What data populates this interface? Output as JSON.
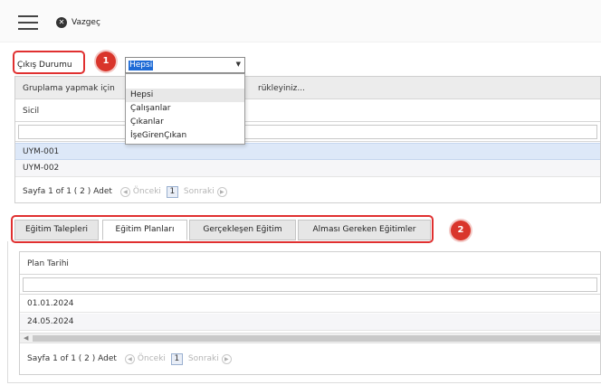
{
  "toolbar": {
    "cancel_label": "Vazgeç",
    "menu_icon": "hamburger-icon",
    "cancel_icon": "close-circle-icon"
  },
  "filter": {
    "label": "Çıkış Durumu",
    "selected": "Hepsi",
    "options": [
      "Hepsi",
      "Çalışanlar",
      "Çıkanlar",
      "İşeGirenÇıkan"
    ]
  },
  "badges": {
    "first": "1",
    "second": "2"
  },
  "top_grid": {
    "group_hint_start": "Gruplama yapmak için",
    "group_hint_end": "rükleyiniz...",
    "column": "Sicil",
    "rows": [
      "UYM-001",
      "UYM-002"
    ],
    "pager": {
      "summary": "Sayfa 1 of 1 ( 2 ) Adet",
      "prev": "Önceki",
      "page": "1",
      "next": "Sonraki"
    }
  },
  "tabs": [
    "Eğitim Talepleri",
    "Eğitim Planları",
    "Gerçekleşen Eğitim",
    "Alması Gereken Eğitimler"
  ],
  "active_tab": "Eğitim Planları",
  "bottom_grid": {
    "column": "Plan Tarihi",
    "rows": [
      "01.01.2024",
      "24.05.2024"
    ],
    "pager": {
      "summary": "Sayfa 1 of 1 ( 2 ) Adet",
      "prev": "Önceki",
      "page": "1",
      "next": "Sonraki"
    }
  },
  "colors": {
    "accent_red": "#e03030",
    "badge_red": "#d9352b",
    "selection_blue": "#1e6bd6"
  }
}
